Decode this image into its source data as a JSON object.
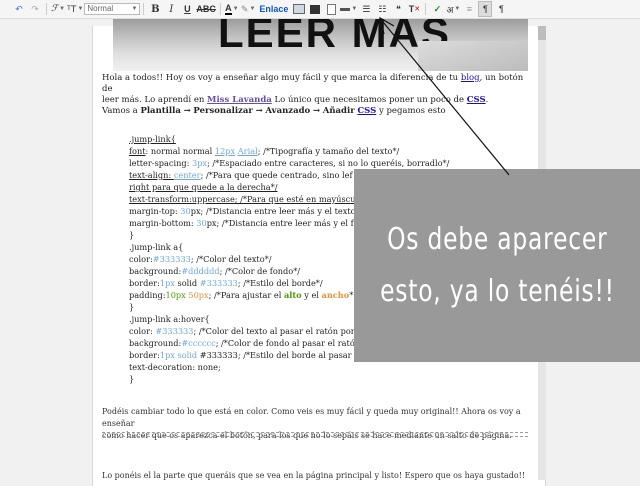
{
  "toolbar": {
    "font_select": "Normal",
    "bold": "B",
    "italic": "I",
    "underline": "U",
    "strike": "ABC",
    "text_color": "A",
    "link": "Enlace",
    "quote": "❝",
    "translit": "अ",
    "pilcrow": "¶"
  },
  "banner": {
    "text": "LEER MÁS"
  },
  "intro": {
    "p1_a": "Hola a todos!! Hoy os voy a enseñar algo muy fácil y que marca la diferencia de tu ",
    "p1_link": "blog",
    "p1_b": ", un botón de",
    "p2_a": "leer más. Lo aprendí en ",
    "p2_link": "Miss Lavanda",
    "p2_b": " Lo único que necesitamos poner un poco de ",
    "p2_css": "CSS",
    "p2_c": ".",
    "p3_a": "Vamos a ",
    "p3_plantilla": "Plantilla",
    "p3_personalizar": "Personalizar",
    "p3_avanzado": "Avanzado",
    "p3_anadir": "Añadir",
    "p3_css": "CSS",
    "p3_b": " y pegamos esto",
    "arrow": "→"
  },
  "code": {
    "l1": ".jump-link{",
    "l2_a": "font",
    "l2_b": ": normal normal ",
    "l2_num": "12px",
    "l2_font": "Arial",
    "l2_c": "; /*Tipografía y tamaño del texto*/",
    "l3_a": "letter-spacing: ",
    "l3_num": "3px",
    "l3_b": "; /*Espaciado entre caracteres, si no lo queréis, borradlo*/",
    "l4_a": "text-align: ",
    "l4_kw": "center",
    "l4_b": "; /*Para que quede centrado, sino lef",
    "l5": "right para que quede a la derecha*/",
    "l6": "text-transform:uppercase; /*Para que esté en mayúscu",
    "l7_a": "margin-top: ",
    "l7_num": "30",
    "l7_b": "px; /*Distancia entre leer más y el texto",
    "l8_a": "margin-bottom: ",
    "l8_num": "30",
    "l8_b": "px; /*Distancia entre leer más y el f",
    "l9": "}",
    "l10": ".jump-link a{",
    "l11_a": "color:",
    "l11_num": "#333333",
    "l11_b": "; /*Color del texto*/",
    "l12_a": "background:",
    "l12_num": "#dddddd",
    "l12_b": "; /*Color de fondo*/",
    "l13_a": "border:",
    "l13_num": "1px",
    "l13_b": " solid ",
    "l13_col": "#333333",
    "l13_c": "; /*Estilo del borde*/",
    "l14_a": "padding:",
    "l14_num1": "10px",
    "l14_num2": "50px",
    "l14_b": "; /*Para ajustar el ",
    "l14_alto": "alto",
    "l14_c": " y el ",
    "l14_ancho": "ancho",
    "l14_d": "*",
    "l15": "}",
    "l16": ".jump-link a:hover{",
    "l17_a": "color: ",
    "l17_num": "#333333",
    "l17_b": "; /*Color del texto al pasar el ratón por",
    "l18_a": "background:",
    "l18_num": "#cccccc",
    "l18_b": "; /*Color de fondo al pasar el ratón",
    "l19_a": "border:",
    "l19_num": "1px solid",
    "l19_b": " #333333; /*Estilo del borde al pasar",
    "l20": "text-decoration: none;",
    "l21": "}"
  },
  "outro": {
    "p1": "Podéis cambiar todo lo que está en color. Como veis es muy fácil y queda muy original!! Ahora os voy a enseñar",
    "p2": "como hacer que os aparezca el botón, para los que no lo sepáis se hace mediante un salto de página.",
    "p3": "Lo ponéis el la parte que queráis que se vea en la página principal y listo! Espero que os haya gustado!!"
  },
  "overlay": {
    "line1": "Os debe aparecer",
    "line2": "esto, ya lo tenéis!!"
  }
}
